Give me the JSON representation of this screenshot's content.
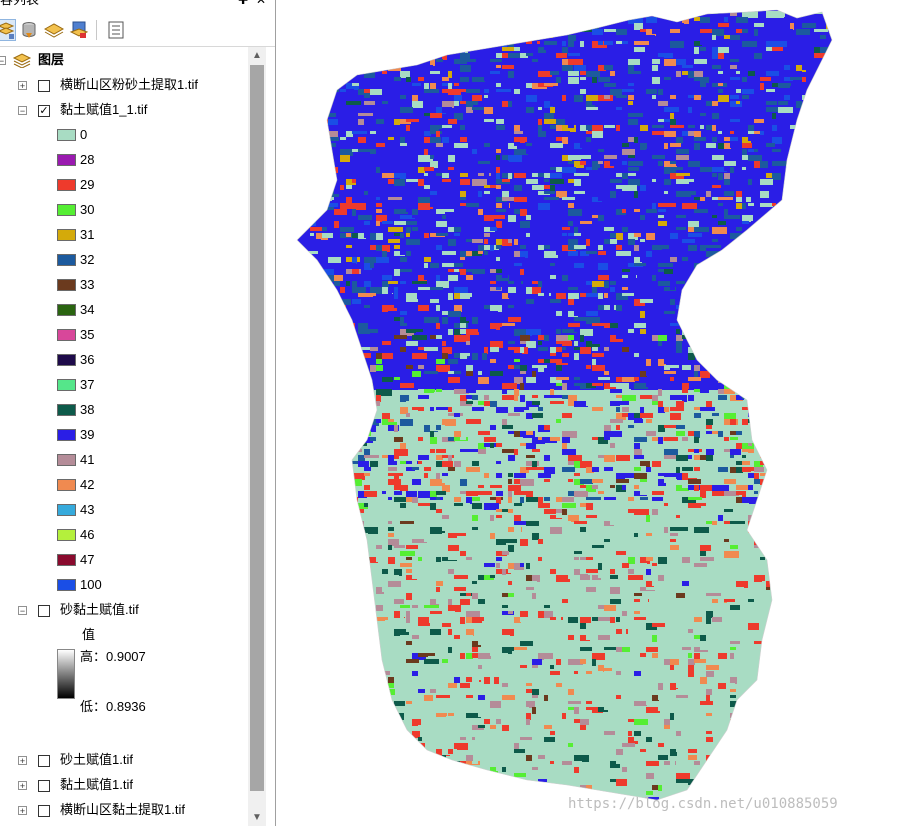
{
  "toc": {
    "title": "容列表",
    "pin_glyph": "✚",
    "close_glyph": "✕",
    "toolbar": [
      "list-by-drawing-order-icon",
      "list-by-source-icon",
      "list-by-visibility-icon",
      "list-by-selection-icon",
      "options-icon"
    ],
    "root_label": "图层",
    "layers": [
      {
        "label": "横断山区粉砂土提取1.tif",
        "checked": false,
        "expanded": false
      },
      {
        "label": "黏土赋值1_1.tif",
        "checked": true,
        "expanded": true
      },
      {
        "label": "砂黏土赋值.tif",
        "checked": false,
        "expanded": true
      },
      {
        "label": "砂土赋值1.tif",
        "checked": false,
        "expanded": false
      },
      {
        "label": "黏土赋值1.tif",
        "checked": false,
        "expanded": false
      },
      {
        "label": "横断山区黏土提取1.tif",
        "checked": false,
        "expanded": false
      }
    ],
    "classes": [
      {
        "value": "0",
        "color": "#a8dcc3"
      },
      {
        "value": "28",
        "color": "#9a1ab0"
      },
      {
        "value": "29",
        "color": "#ee3a2c"
      },
      {
        "value": "30",
        "color": "#55ee33"
      },
      {
        "value": "31",
        "color": "#d4aa0a"
      },
      {
        "value": "32",
        "color": "#1c5a9e"
      },
      {
        "value": "33",
        "color": "#6b3a1e"
      },
      {
        "value": "34",
        "color": "#2a6410"
      },
      {
        "value": "35",
        "color": "#d8479a"
      },
      {
        "value": "36",
        "color": "#1e0a4a"
      },
      {
        "value": "37",
        "color": "#55e68a"
      },
      {
        "value": "38",
        "color": "#0d5a4a"
      },
      {
        "value": "39",
        "color": "#2a1ee6"
      },
      {
        "value": "41",
        "color": "#b48c98"
      },
      {
        "value": "42",
        "color": "#f08a50"
      },
      {
        "value": "43",
        "color": "#36aadc"
      },
      {
        "value": "46",
        "color": "#b4f03c"
      },
      {
        "value": "47",
        "color": "#8a0a2e"
      },
      {
        "value": "100",
        "color": "#1a4ee6"
      }
    ],
    "stretch": {
      "heading": "值",
      "high": "高：0.9007",
      "low": "低：0.8936"
    },
    "scroll": {
      "up": "▲",
      "down": "▼"
    }
  },
  "map": {
    "watermark": "https://blog.csdn.net/u010885059"
  }
}
